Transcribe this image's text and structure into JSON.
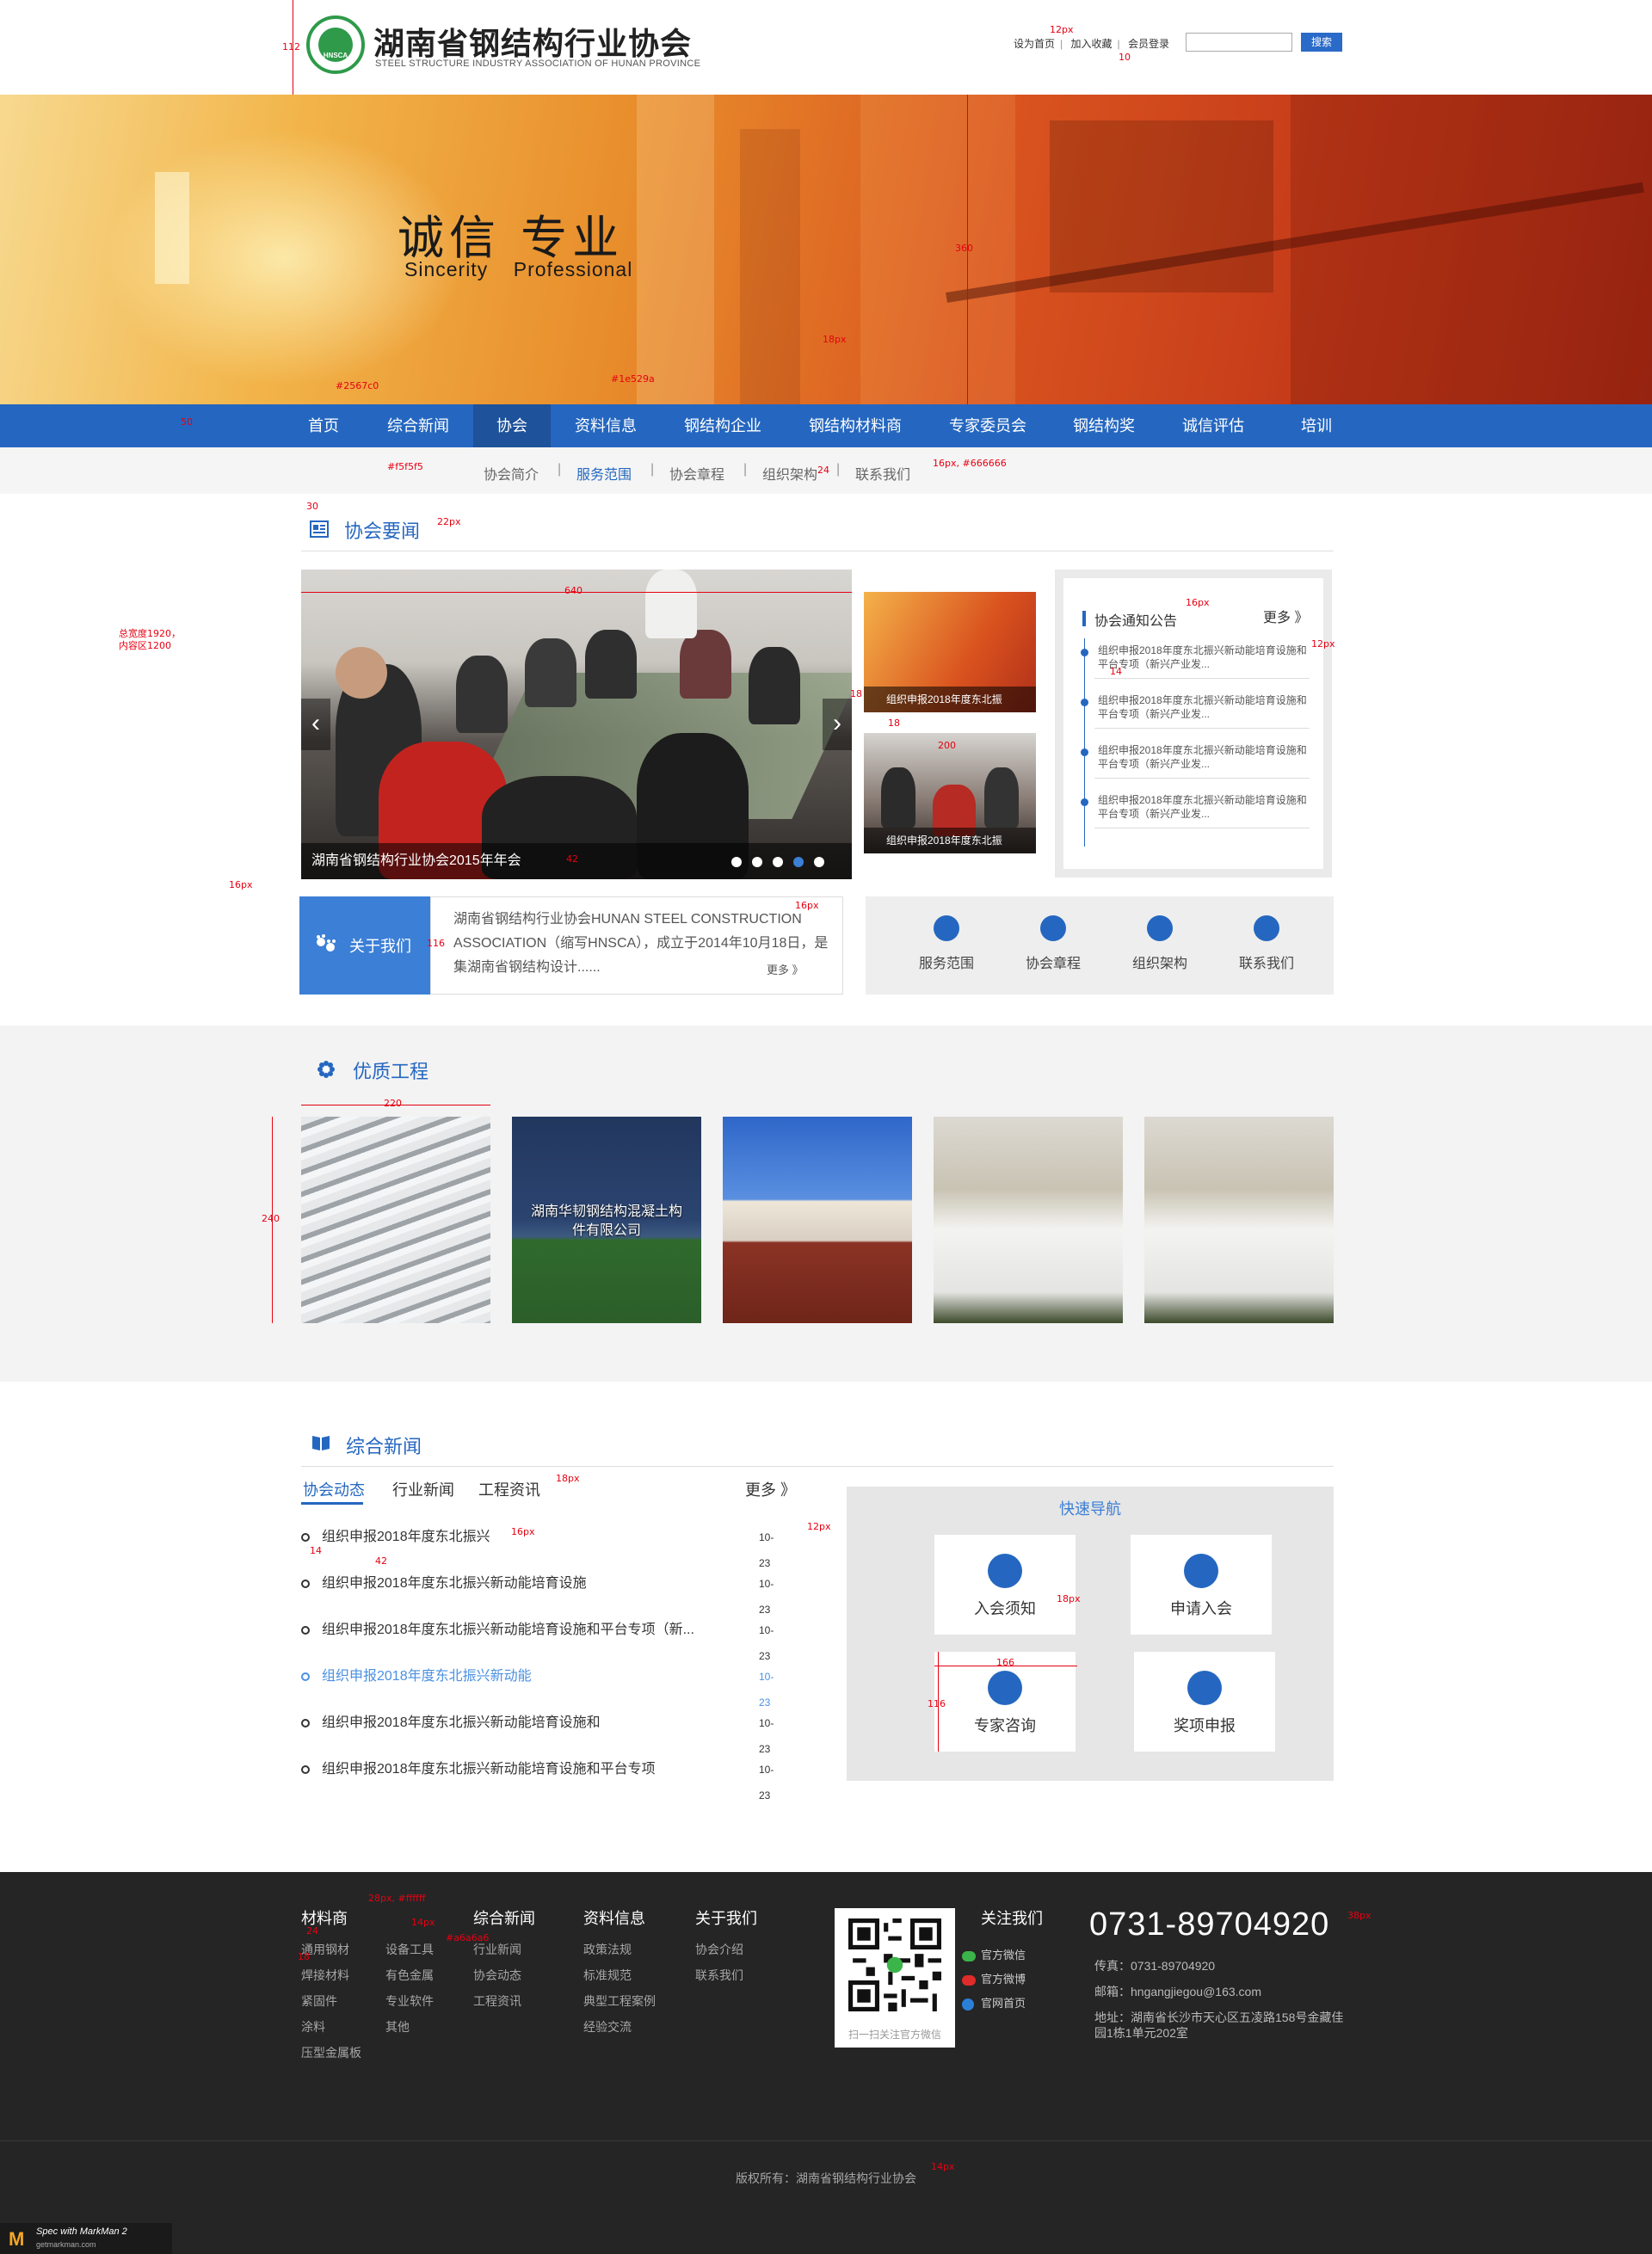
{
  "header": {
    "logo_badge": "HNSCA",
    "logo_cn": "湖南省钢结构行业协会",
    "logo_en": "STEEL STRUCTURE INDUSTRY ASSOCIATION OF HUNAN PROVINCE",
    "links": [
      "设为首页",
      "加入收藏",
      "会员登录"
    ],
    "search_placeholder": "",
    "search_button": "搜索"
  },
  "banner": {
    "title_cn": "诚信 专业",
    "title_en": "Sincerity    Professional"
  },
  "nav": {
    "items": [
      "首页",
      "综合新闻",
      "协会",
      "资料信息",
      "钢结构企业",
      "钢结构材料商",
      "专家委员会",
      "钢结构奖",
      "诚信评估",
      "培训"
    ],
    "active": "协会"
  },
  "subnav": {
    "items": [
      "协会简介",
      "服务范围",
      "协会章程",
      "组织架构",
      "联系我们"
    ],
    "active": "服务范围"
  },
  "assoc_news": {
    "title": "协会要闻",
    "carousel_caption": "湖南省钢结构行业协会2015年年会",
    "thumb_captions": [
      "组织申报2018年度东北振",
      "组织申报2018年度东北振"
    ],
    "notice": {
      "title": "协会通知公告",
      "more": "更多 》",
      "items": [
        "组织申报2018年度东北振兴新动能培育设施和平台专项（新兴产业发...",
        "组织申报2018年度东北振兴新动能培育设施和平台专项（新兴产业发...",
        "组织申报2018年度东北振兴新动能培育设施和平台专项（新兴产业发...",
        "组织申报2018年度东北振兴新动能培育设施和平台专项（新兴产业发..."
      ]
    },
    "about": {
      "tab": "关于我们",
      "text": "湖南省钢结构行业协会HUNAN STEEL CONSTRUCTION ASSOCIATION（缩写HNSCA），成立于2014年10月18日，是集湖南省钢结构设计......",
      "more": "更多 》"
    },
    "quick": [
      "服务范围",
      "协会章程",
      "组织架构",
      "联系我们"
    ]
  },
  "projects": {
    "title": "优质工程",
    "items": [
      "",
      "湖南华韧钢结构混凝土构件有限公司",
      "",
      "",
      ""
    ]
  },
  "news": {
    "title": "综合新闻",
    "tabs": [
      "协会动态",
      "行业新闻",
      "工程资讯"
    ],
    "more": "更多 》",
    "rows": [
      {
        "title": "组织申报2018年度东北振兴",
        "date": "10-23"
      },
      {
        "title": "组织申报2018年度东北振兴新动能培育设施",
        "date": "10-23"
      },
      {
        "title": "组织申报2018年度东北振兴新动能培育设施和平台专项（新...",
        "date": "10-23"
      },
      {
        "title": "组织申报2018年度东北振兴新动能",
        "date": "10-23"
      },
      {
        "title": "组织申报2018年度东北振兴新动能培育设施和",
        "date": "10-23"
      },
      {
        "title": "组织申报2018年度东北振兴新动能培育设施和平台专项",
        "date": "10-23"
      }
    ],
    "highlight_index": 3,
    "quicknav_title": "快速导航",
    "quicknav": [
      "入会须知",
      "申请入会",
      "专家咨询",
      "奖项申报"
    ]
  },
  "footer": {
    "columns": [
      {
        "title": "材料商",
        "links": [
          "通用钢材",
          "焊接材料",
          "紧固件",
          "涂料",
          "压型金属板"
        ]
      },
      {
        "title": "",
        "links": [
          "设备工具",
          "有色金属",
          "专业软件",
          "其他"
        ]
      },
      {
        "title": "综合新闻",
        "links": [
          "行业新闻",
          "协会动态",
          "工程资讯"
        ]
      },
      {
        "title": "资料信息",
        "links": [
          "政策法规",
          "标准规范",
          "典型工程案例",
          "经验交流"
        ]
      },
      {
        "title": "关于我们",
        "links": [
          "协会介绍",
          "联系我们"
        ]
      }
    ],
    "qr_caption": "扫一扫关注官方微信",
    "follow_title": "关注我们",
    "follow": [
      "官方微信",
      "官方微博",
      "官网首页"
    ],
    "phone": "0731-89704920",
    "fax": "传真：0731-89704920",
    "email": "邮箱：hngangjiegou@163.com",
    "address": "地址：湖南省长沙市天心区五凌路158号金藏佳园1栋1单元202室",
    "copyright": "版权所有：湖南省钢结构行业协会"
  },
  "markman": {
    "line1": "Spec with MarkMan 2",
    "line2": "getmarkman.com"
  },
  "annotations": {
    "a112": "112",
    "a12px": "12px",
    "a10": "10",
    "a360": "360",
    "a18px": "18px",
    "a2567c0": "#2567c0",
    "a1e529a": "#1e529a",
    "a50": "50",
    "af5f5f5": "#f5f5f5",
    "a24": "24",
    "a16px666": "16px, #666666",
    "a30": "30",
    "a22px": "22px",
    "a640": "640",
    "a16px": "16px",
    "a12px2": "12px",
    "a14": "14",
    "a18": "18",
    "a200": "200",
    "a42": "42",
    "a116": "116",
    "atotal": "总宽度1920，\n内容区1200",
    "a220": "220",
    "a240": "240",
    "a166": "166",
    "a28px": "28px, #ffffff",
    "a14px": "14px",
    "aa6": "#a6a6a6",
    "a38px": "38px",
    "a14px2": "14px"
  }
}
